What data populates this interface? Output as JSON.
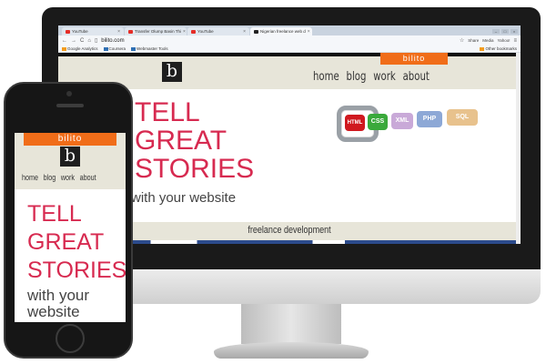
{
  "browser": {
    "tabs": [
      {
        "title": "YouTube",
        "icon": "youtube-icon"
      },
      {
        "title": "Transfer Olump Basin Thi",
        "icon": "youtube-icon"
      },
      {
        "title": "YouTube",
        "icon": "youtube-icon"
      },
      {
        "title": "Nigerian freelance web d",
        "icon": "bilito-icon"
      }
    ],
    "url": "bilito.com",
    "extensions": [
      "Share",
      "Media",
      "Yahoo!"
    ],
    "bookmarks": [
      "Google Analytics",
      "Coursera",
      "Webmaster Tools"
    ],
    "other_bookmarks": "Other bookmarks"
  },
  "site": {
    "brand": "bilito",
    "logo_letter": "b",
    "nav": [
      "home",
      "blog",
      "work",
      "about"
    ],
    "hero_title_lines": [
      "TELL",
      "GREAT",
      "STORIES"
    ],
    "hero_subtitle": "with your website",
    "tech_badges": [
      "HTML",
      "CSS",
      "XML",
      "PHP",
      "SQL"
    ],
    "band_text": "freelance development",
    "accent": "#f06d19",
    "title_color": "#d72a50"
  },
  "phone": {
    "brand": "bilito",
    "logo_letter": "b",
    "nav": [
      "home",
      "blog",
      "work",
      "about"
    ],
    "hero_title_lines": [
      "TELL",
      "GREAT",
      "STORIES"
    ],
    "hero_subtitle_lines": [
      "with your",
      "website"
    ]
  }
}
